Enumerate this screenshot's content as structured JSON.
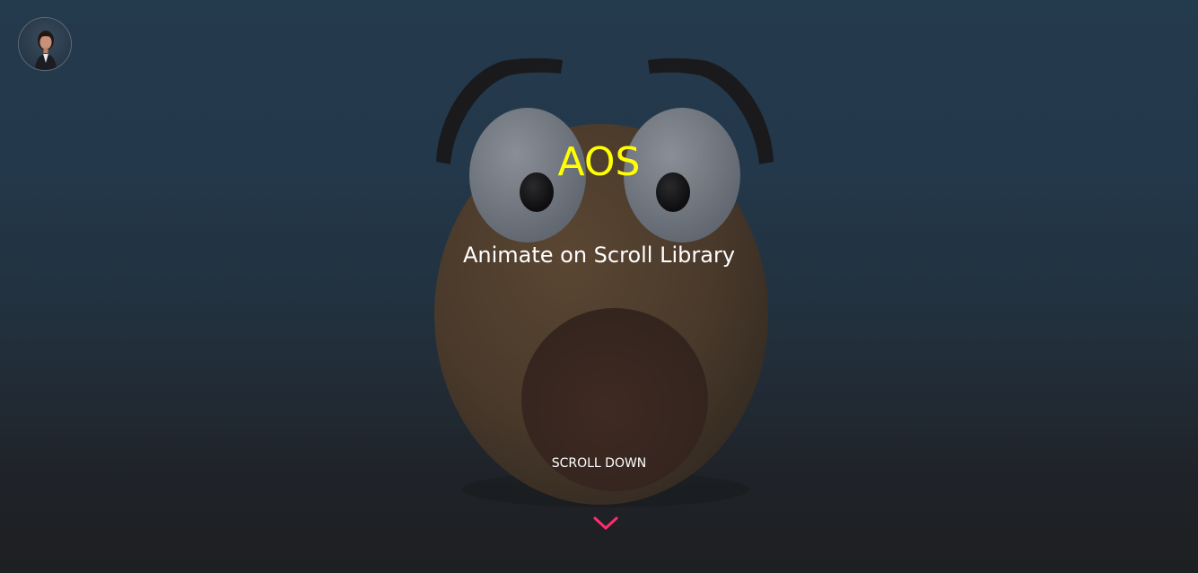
{
  "hero": {
    "title": "AOS",
    "subtitle": "Animate on Scroll Library",
    "scroll_label": "SCROLL DOWN"
  },
  "icons": {
    "avatar": "profile-avatar",
    "scroll": "chevron-down-icon",
    "illustration": "surprised-face-illustration"
  },
  "colors": {
    "title": "#ffff00",
    "subtitle": "#ffffff",
    "chevron": "#ff2d6e",
    "background_top": "#243a4d",
    "background_bottom": "#1e1f22"
  }
}
